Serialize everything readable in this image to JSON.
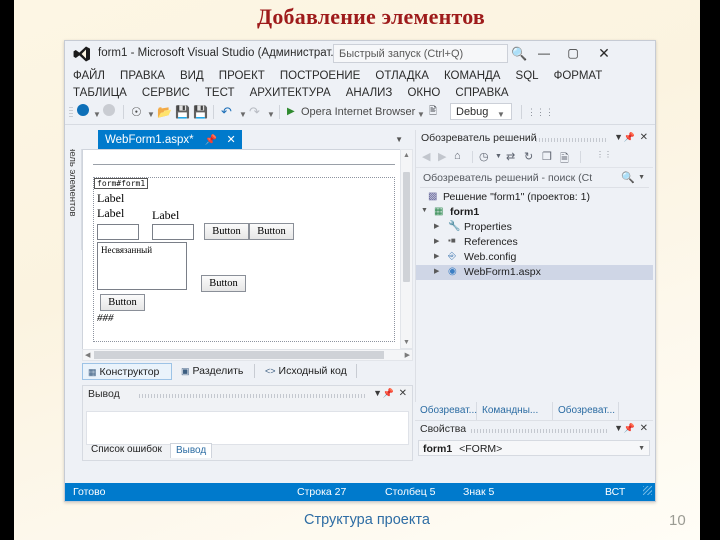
{
  "slide": {
    "title": "Добавление элементов",
    "caption": "Структура проекта",
    "page_number": "10",
    "title_color": "#9e1b1b",
    "caption_color": "#2e6da4",
    "background_color": "#fdf6e4"
  },
  "vs": {
    "titlebar": {
      "logo_icon": "visual-studio-logo-icon",
      "title": "form1 - Microsoft Visual Studio (Администрат...",
      "quick_launch_placeholder": "Быстрый запуск (Ctrl+Q)",
      "search_icon": "search-icon",
      "minimize": "—",
      "maximize": "▢",
      "close": "✕"
    },
    "menus_row1": [
      "ФАЙЛ",
      "ПРАВКА",
      "ВИД",
      "ПРОЕКТ",
      "ПОСТРОЕНИЕ",
      "ОТЛАДКА",
      "КОМАНДА",
      "SQL",
      "ФОРМАТ"
    ],
    "menus_row2": [
      "ТАБЛИЦА",
      "СЕРВИС",
      "ТЕСТ",
      "АРХИТЕКТУРА",
      "АНАЛИЗ",
      "ОКНО",
      "СПРАВКА"
    ],
    "toolbar": {
      "back_icon": "navigate-back-icon",
      "forward_icon": "navigate-forward-icon",
      "new_project_icon": "new-project-icon",
      "open_file_icon": "open-file-icon",
      "save_icon": "save-icon",
      "save_all_icon": "save-all-icon",
      "undo_icon": "undo-icon",
      "redo_icon": "redo-icon",
      "run_icon": "start-debug-icon",
      "run_label": "Opera Internet Browser",
      "browser_icon": "browse-with-icon",
      "config_value": "Debug",
      "overflow_icon": "toolbar-overflow-icon"
    },
    "document_tab": {
      "label": "WebForm1.aspx*",
      "pin_icon": "pin-icon",
      "close_icon": "close-icon",
      "dropdown_icon": "chevron-down-icon"
    },
    "toolbox_tab_label": "Панель элементов",
    "designer": {
      "form_tag": "form#form1",
      "labels": [
        "Label",
        "Label",
        "Label"
      ],
      "textbox_count": 2,
      "buttons": [
        "Button",
        "Button",
        "Button",
        "Button"
      ],
      "listbox_item": "Несвязанный",
      "placeholder_text": "###"
    },
    "view_tabs": [
      {
        "label": "Конструктор",
        "icon": "designer-view-icon",
        "active": true
      },
      {
        "label": "Разделить",
        "icon": "split-view-icon",
        "active": false
      },
      {
        "label": "Исходный код",
        "icon": "source-view-icon",
        "active": false
      }
    ],
    "output_pane": {
      "title": "Вывод",
      "dropdown_icon": "chevron-down-icon",
      "pin_icon": "pin-icon",
      "close_icon": "close-icon",
      "tabs": [
        {
          "label": "Список ошибок",
          "active": false
        },
        {
          "label": "Вывод",
          "active": true
        }
      ]
    },
    "solution_explorer": {
      "title": "Обозреватель решений",
      "dropdown_icon": "chevron-down-icon",
      "pin_icon": "pin-icon",
      "close_icon": "close-icon",
      "toolbar_icons": [
        "navigate-back-icon",
        "navigate-forward-icon",
        "home-icon",
        "pending-changes-icon",
        "sync-with-active-document-icon",
        "refresh-icon",
        "collapse-all-icon",
        "show-all-files-icon"
      ],
      "search_placeholder": "Обозреватель решений - поиск (Ct",
      "search_icon": "search-icon",
      "tree": [
        {
          "label": "Решение \"form1\"  (проектов: 1)",
          "icon": "solution-icon",
          "indent": 0,
          "twisty": false,
          "bold": false,
          "selected": false
        },
        {
          "label": "form1",
          "icon": "project-icon",
          "indent": 1,
          "twisty": true,
          "expanded": true,
          "bold": true,
          "selected": false
        },
        {
          "label": "Properties",
          "icon": "properties-icon",
          "indent": 2,
          "twisty": true,
          "expanded": false,
          "bold": false,
          "selected": false
        },
        {
          "label": "References",
          "icon": "references-icon",
          "indent": 2,
          "twisty": true,
          "expanded": false,
          "bold": false,
          "selected": false
        },
        {
          "label": "Web.config",
          "icon": "config-file-icon",
          "indent": 2,
          "twisty": true,
          "expanded": false,
          "bold": false,
          "selected": false
        },
        {
          "label": "WebForm1.aspx",
          "icon": "aspx-file-icon",
          "indent": 2,
          "twisty": true,
          "expanded": false,
          "bold": false,
          "selected": true
        }
      ]
    },
    "right_bottom_tabs": [
      "Обозреват...",
      "Командны...",
      "Обозреват..."
    ],
    "properties": {
      "title": "Свойства",
      "dropdown_icon": "chevron-down-icon",
      "pin_icon": "pin-icon",
      "close_icon": "close-icon",
      "object_name": "form1",
      "object_type": "<FORM>"
    },
    "statusbar": {
      "status": "Готово",
      "line": "Строка 27",
      "column": "Столбец 5",
      "char": "Знак 5",
      "insert_mode": "ВСТ",
      "accent_color": "#007acc"
    }
  }
}
